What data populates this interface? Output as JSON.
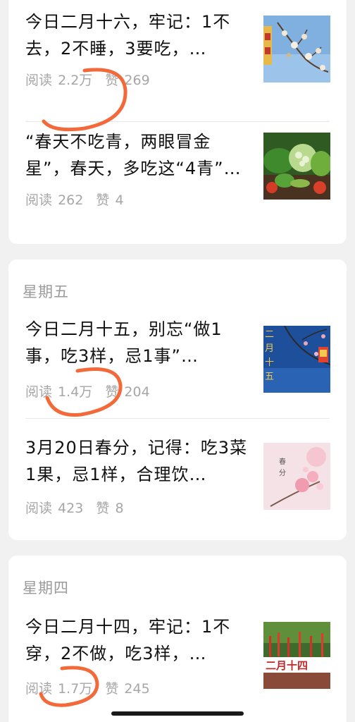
{
  "cards": [
    {
      "day_label": "",
      "articles": [
        {
          "title": "今日二月十六，牢记：1不去，2不睡，3要吃，…",
          "reads_label": "阅读",
          "reads": "2.2万",
          "likes_label": "赞",
          "likes": "269",
          "thumb_icon": "plum-blossom-image"
        },
        {
          "title": "“春天不吃青，两眼冒金星”，春天，多吃这“4青”…",
          "reads_label": "阅读",
          "reads": "262",
          "likes_label": "赞",
          "likes": "4",
          "thumb_icon": "vegetables-image"
        }
      ]
    },
    {
      "day_label": "星期五",
      "articles": [
        {
          "title": "今日二月十五，别忘“做1事，吃3样，忌1事”…",
          "reads_label": "阅读",
          "reads": "1.4万",
          "likes_label": "赞",
          "likes": "204",
          "thumb_icon": "blossom-lantern-image",
          "thumb_text": "二月十五"
        },
        {
          "title": "3月20日春分，记得：吃3菜1果，忌1样，合理饮…",
          "reads_label": "阅读",
          "reads": "423",
          "likes_label": "赞",
          "likes": "8",
          "thumb_icon": "spring-equinox-image",
          "thumb_text": "春分"
        }
      ]
    },
    {
      "day_label": "星期四",
      "articles": [
        {
          "title": "今日二月十四，牢记：1不穿，2不做，吃3样，…",
          "reads_label": "阅读",
          "reads": "1.7万",
          "likes_label": "赞",
          "likes": "245",
          "thumb_icon": "red-ribbons-image",
          "thumb_text": "二月十四"
        }
      ]
    }
  ],
  "colors": {
    "accent_green": "#07c160",
    "annotation_orange": "#f4693a"
  }
}
